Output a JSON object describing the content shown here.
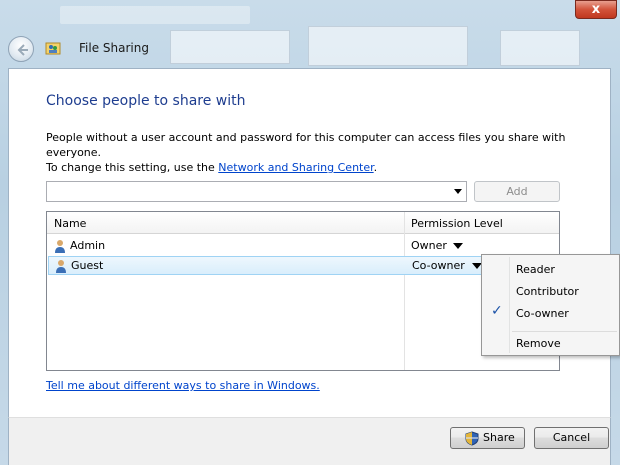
{
  "window": {
    "title": "File Sharing",
    "close_glyph": "x"
  },
  "page": {
    "heading": "Choose people to share with",
    "description_line1": "People without a user account and password for this computer can access files you share with everyone.",
    "description_line2_prefix": "To change this setting, use the ",
    "description_link": "Network and Sharing Center",
    "description_line2_suffix": "."
  },
  "add_box": {
    "value": "",
    "add_label": "Add"
  },
  "table": {
    "columns": [
      "Name",
      "Permission Level"
    ],
    "rows": [
      {
        "name": "Admin",
        "permission": "Owner"
      },
      {
        "name": "Guest",
        "permission": "Co-owner"
      }
    ]
  },
  "bottom_link": "Tell me about different ways to share in Windows.",
  "footer": {
    "share_label": "Share",
    "cancel_label": "Cancel"
  },
  "permission_menu": {
    "items": [
      "Reader",
      "Contributor",
      "Co-owner",
      "Remove"
    ],
    "checked": "Co-owner",
    "check_glyph": "✓"
  },
  "colors": {
    "heading": "#1e3d8f",
    "link": "#0044cc",
    "selection": "#d9eefc"
  }
}
